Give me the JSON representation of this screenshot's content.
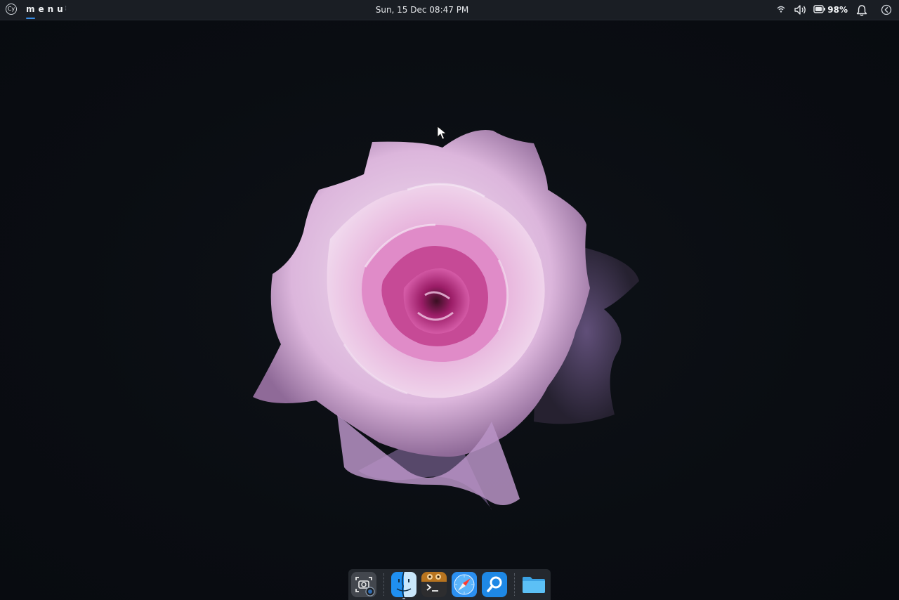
{
  "top_bar": {
    "logo_text": "Cy",
    "menu_label": "menu",
    "clock": "Sun, 15 Dec 08:47 PM",
    "battery_percent": "98%"
  },
  "icons": {
    "logo": "cy-logo-icon",
    "wifi": "wifi-icon",
    "volume": "volume-icon",
    "battery": "battery-icon",
    "notifications": "bell-icon",
    "sidebar_toggle": "chevron-left-icon"
  },
  "dock": {
    "apps": [
      {
        "name": "Screenshot",
        "icon": "screenshot-camera-icon"
      },
      {
        "name": "Finder",
        "icon": "finder-face-icon"
      },
      {
        "name": "Terminal",
        "icon": "terminal-icon"
      },
      {
        "name": "Safari",
        "icon": "compass-icon"
      },
      {
        "name": "Search",
        "icon": "magnifier-icon"
      },
      {
        "name": "Files",
        "icon": "folder-icon"
      }
    ]
  },
  "colors": {
    "panel_bg": "#1a1e24",
    "desktop_bg": "#0b0f14",
    "accent": "#3a8ee6",
    "flower_light": "#e7cfe6",
    "flower_mid": "#c98fc6",
    "flower_core": "#b8307f"
  }
}
